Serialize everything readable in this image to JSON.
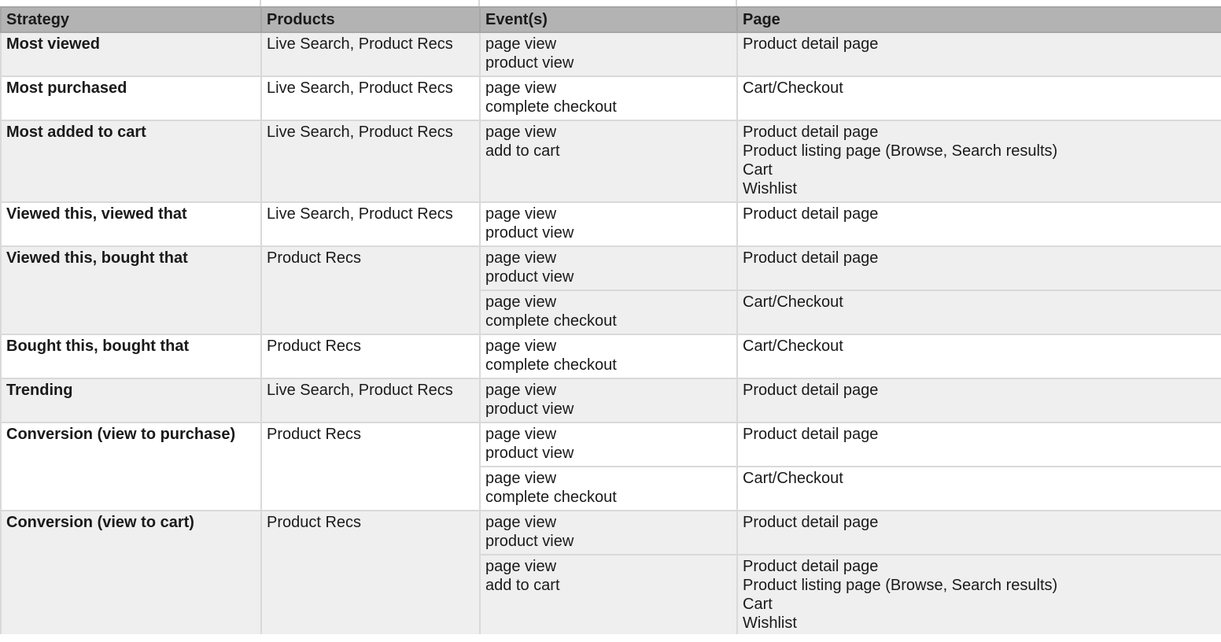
{
  "headers": [
    "Strategy",
    "Products",
    "Event(s)",
    "Page"
  ],
  "rows": [
    {
      "strategy": "Most viewed",
      "products": "Live Search, Product Recs",
      "subrows": [
        {
          "events": [
            "page view",
            "product view"
          ],
          "pages": [
            "Product detail page"
          ]
        }
      ]
    },
    {
      "strategy": "Most purchased",
      "products": "Live Search, Product Recs",
      "subrows": [
        {
          "events": [
            "page view",
            "complete checkout"
          ],
          "pages": [
            "Cart/Checkout"
          ]
        }
      ]
    },
    {
      "strategy": "Most added to cart",
      "products": "Live Search, Product Recs",
      "subrows": [
        {
          "events": [
            "page view",
            "add to cart"
          ],
          "pages": [
            "Product detail page",
            "Product listing page (Browse, Search results)",
            "Cart",
            "Wishlist"
          ]
        }
      ]
    },
    {
      "strategy": "Viewed this, viewed that",
      "products": "Live Search, Product Recs",
      "subrows": [
        {
          "events": [
            "page view",
            "product view"
          ],
          "pages": [
            "Product detail page"
          ]
        }
      ]
    },
    {
      "strategy": "Viewed this, bought that",
      "products": "Product Recs",
      "subrows": [
        {
          "events": [
            "page view",
            "product view"
          ],
          "pages": [
            "Product detail page"
          ]
        },
        {
          "events": [
            "page view",
            "complete checkout"
          ],
          "pages": [
            "Cart/Checkout"
          ]
        }
      ]
    },
    {
      "strategy": "Bought this, bought that",
      "products": "Product Recs",
      "subrows": [
        {
          "events": [
            "page view",
            "complete checkout"
          ],
          "pages": [
            "Cart/Checkout"
          ]
        }
      ]
    },
    {
      "strategy": "Trending",
      "products": "Live Search, Product Recs",
      "subrows": [
        {
          "events": [
            "page view",
            "product view"
          ],
          "pages": [
            "Product detail page"
          ]
        }
      ]
    },
    {
      "strategy": "Conversion (view to purchase)",
      "products": "Product Recs",
      "subrows": [
        {
          "events": [
            "page view",
            "product view"
          ],
          "pages": [
            "Product detail page"
          ]
        },
        {
          "events": [
            "page view",
            "complete checkout"
          ],
          "pages": [
            "Cart/Checkout"
          ]
        }
      ]
    },
    {
      "strategy": "Conversion (view to cart)",
      "products": "Product Recs",
      "subrows": [
        {
          "events": [
            "page view",
            "product view"
          ],
          "pages": [
            "Product detail page"
          ]
        },
        {
          "events": [
            "page view",
            "add to cart"
          ],
          "pages": [
            "Product detail page",
            "Product listing page (Browse, Search results)",
            "Cart",
            "Wishlist"
          ]
        }
      ]
    }
  ]
}
